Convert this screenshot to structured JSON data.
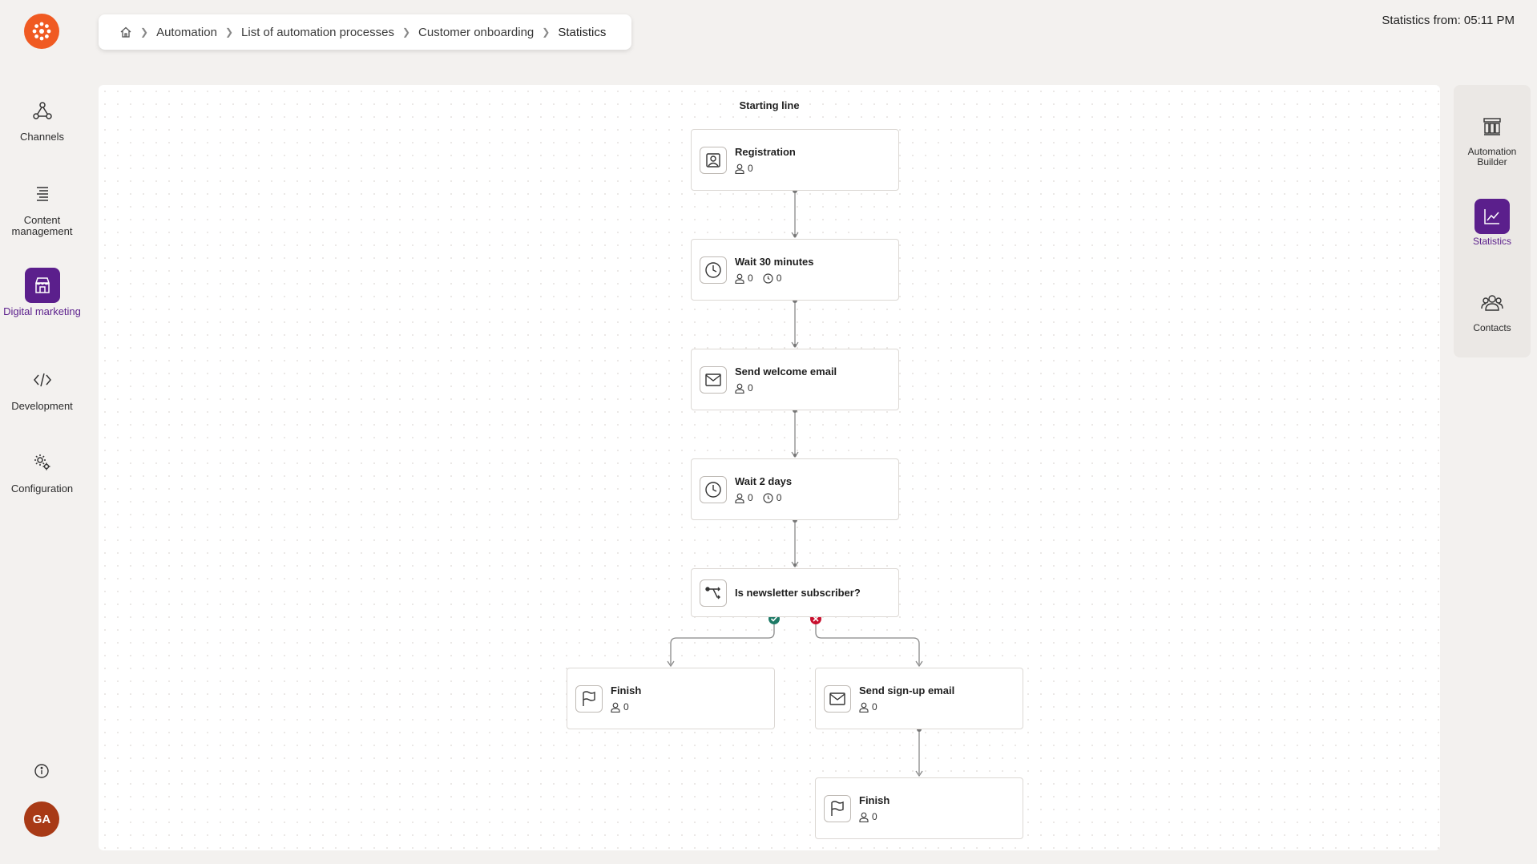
{
  "app": {
    "brand_color": "#f05a22",
    "accent_color": "#5b1f8c"
  },
  "leftnav": {
    "items": [
      {
        "label": "Channels",
        "icon": "channels-icon"
      },
      {
        "label": "Content management",
        "icon": "content-management-icon"
      },
      {
        "label": "Digital marketing",
        "icon": "digital-marketing-icon",
        "active": true
      },
      {
        "label": "Development",
        "icon": "code-icon"
      },
      {
        "label": "Configuration",
        "icon": "gear-icon"
      }
    ],
    "avatar_initials": "GA"
  },
  "breadcrumb": {
    "items": [
      "Automation",
      "List of automation processes",
      "Customer onboarding",
      "Statistics"
    ]
  },
  "header": {
    "stats_from": "Statistics from: 05:11 PM"
  },
  "canvas": {
    "starting_line": "Starting line",
    "nodes": [
      {
        "title": "Registration",
        "icon": "contact-form-icon",
        "contacts": "0"
      },
      {
        "title": "Wait 30 minutes",
        "icon": "clock-icon",
        "contacts": "0",
        "waiting": "0"
      },
      {
        "title": "Send welcome email",
        "icon": "envelope-icon",
        "contacts": "0"
      },
      {
        "title": "Wait 2 days",
        "icon": "clock-icon",
        "contacts": "0",
        "waiting": "0"
      },
      {
        "title": "Is newsletter subscriber?",
        "icon": "condition-icon"
      },
      {
        "title": "Finish",
        "icon": "flag-icon",
        "contacts": "0"
      },
      {
        "title": "Send sign-up email",
        "icon": "envelope-icon",
        "contacts": "0"
      },
      {
        "title": "Finish",
        "icon": "flag-icon",
        "contacts": "0"
      }
    ],
    "branch_colors": {
      "yes": "#1d7a66",
      "no": "#c8102e"
    }
  },
  "rightpanel": {
    "items": [
      {
        "label": "Automation Builder",
        "icon": "builder-icon"
      },
      {
        "label": "Statistics",
        "icon": "chart-icon",
        "active": true
      },
      {
        "label": "Contacts",
        "icon": "contacts-icon"
      }
    ]
  }
}
